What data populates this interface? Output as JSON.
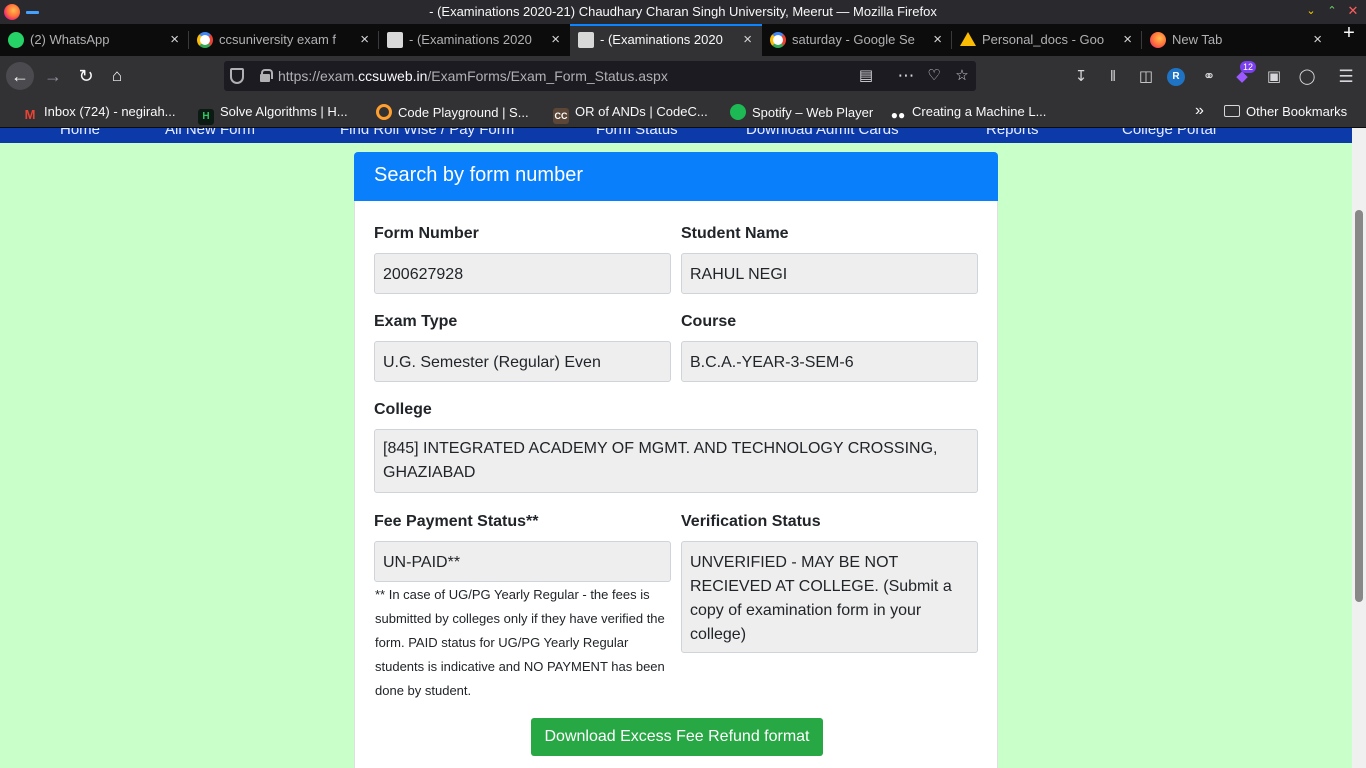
{
  "window": {
    "title": "- (Examinations 2020-21) Chaudhary Charan Singh University, Meerut — Mozilla Firefox"
  },
  "tabs": [
    {
      "label": "(2) WhatsApp",
      "icon": "whatsapp-icon",
      "active": false
    },
    {
      "label": "ccsuniversity exam f",
      "icon": "google-icon",
      "active": false
    },
    {
      "label": "- (Examinations 2020",
      "icon": "university-icon",
      "active": false
    },
    {
      "label": "- (Examinations 2020",
      "icon": "university-icon",
      "active": true
    },
    {
      "label": "saturday - Google Se",
      "icon": "google-icon",
      "active": false
    },
    {
      "label": "Personal_docs - Goo",
      "icon": "google-drive-icon",
      "active": false
    },
    {
      "label": "New Tab",
      "icon": "firefox-icon",
      "active": false
    }
  ],
  "urlbar": {
    "url_prefix": "https://exam.",
    "url_domain": "ccsuweb.in",
    "url_path": "/ExamForms/Exam_Form_Status.aspx"
  },
  "toolbar": {
    "extension_badge": "12",
    "profile_letter": "R"
  },
  "bookmarks": [
    {
      "label": "Inbox (724) - negirah...",
      "icon": "gmail-icon"
    },
    {
      "label": "Solve Algorithms | H...",
      "icon": "hackerrank-icon"
    },
    {
      "label": "Code Playground | S...",
      "icon": "sololearn-icon"
    },
    {
      "label": "OR of ANDs | CodeC...",
      "icon": "codechef-icon"
    },
    {
      "label": "Spotify – Web Player",
      "icon": "spotify-icon"
    },
    {
      "label": "Creating a Machine L...",
      "icon": "medium-icon"
    },
    {
      "label": "Other Bookmarks",
      "icon": "folder-icon"
    }
  ],
  "site_nav": [
    "Home",
    "All New Form",
    "Find Roll Wise / Pay Form",
    "Form Status",
    "Download Admit Cards",
    "Reports",
    "College Portal"
  ],
  "card": {
    "title": "Search by form number",
    "form_number_label": "Form Number",
    "form_number": "200627928",
    "student_name_label": "Student Name",
    "student_name": "RAHUL NEGI",
    "exam_type_label": "Exam Type",
    "exam_type": "U.G. Semester (Regular) Even",
    "course_label": "Course",
    "course": "B.C.A.-YEAR-3-SEM-6",
    "college_label": "College",
    "college": "[845] INTEGRATED ACADEMY OF MGMT. AND TECHNOLOGY CROSSING, GHAZIABAD",
    "fee_status_label": "Fee Payment Status**",
    "fee_status": "UN-PAID**",
    "verification_label": "Verification Status",
    "verification": "UNVERIFIED - MAY BE NOT RECIEVED AT COLLEGE. (Submit a copy of examination form in your college)",
    "note": "** In case of UG/PG Yearly Regular - the fees is submitted by colleges only if they have verified the form. PAID status for UG/PG Yearly Regular students is indicative and NO PAYMENT has been done by student.",
    "download_button": "Download Excess Fee Refund format"
  },
  "colors": {
    "page_bg": "#c9ffc9",
    "card_header": "#0a7ffb",
    "download_button": "#28a745",
    "site_nav": "#0d3aa9"
  }
}
